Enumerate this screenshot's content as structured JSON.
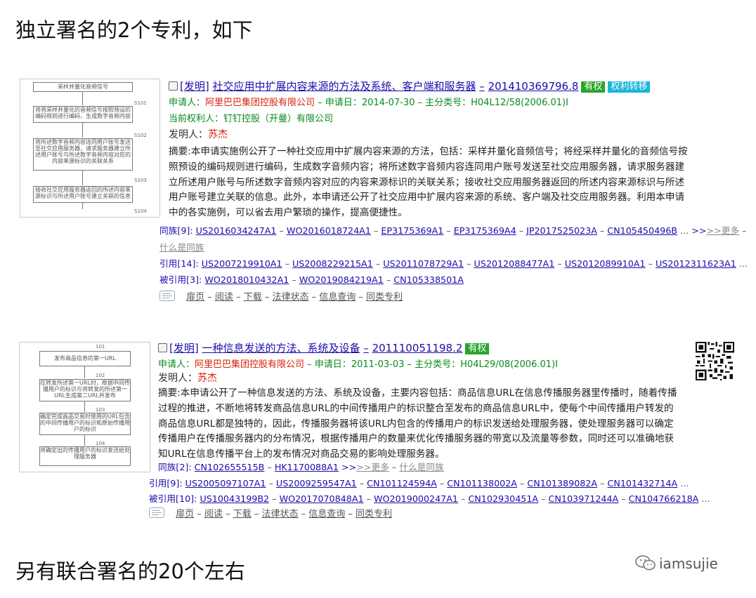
{
  "heading_top": "独立署名的2个专利，如下",
  "heading_bottom": "另有联合署名的20个左右",
  "watermark": "iamsujie",
  "icons": {
    "wechat": "wechat-icon",
    "qr": "qr-code-icon",
    "toolbar": "page-icon",
    "checkbox": "checkbox-icon"
  },
  "colors": {
    "link": "#1a0dab",
    "green": "#0a8a1f",
    "red": "#d9210b",
    "tag_valid": "#2aa52a",
    "tag_transfer": "#18b6d9"
  },
  "patent1": {
    "figure": {
      "top_label": "采样并量化音频信号",
      "boxes": [
        "将将采样并量化的音频信号按照预设的编码规则进行编码，生成数字音频内容",
        "将所述数字音频内容连同用户账号发送至社交应用服务器，请求服务器建立所述用户账号与所述数字音频内容对应的内容来源标识的关联关系",
        "接收社交应用服务器返回的所述内容来源标识与所述用户账号建立关联的信息"
      ],
      "steps": [
        "S101",
        "S102",
        "S103",
        "S104"
      ]
    },
    "type_label": "[发明]",
    "title": "社交应用中扩展内容来源的方法及系统、客户端和服务器",
    "number": "201410369796.8",
    "tags": [
      "有权",
      "权利转移"
    ],
    "applicant_label": "申请人：",
    "applicant": "阿里巴巴集团控股有限公司",
    "app_date_label": "申请日：",
    "app_date": "2014-07-30",
    "class_label": "主分类号：",
    "class": "H04L12/58(2006.01)I",
    "holder_label": "当前权利人：",
    "holder": "钉钉控股（开曼）有限公司",
    "inventor_label": "发明人：",
    "inventor": "苏杰",
    "abstract": [
      "摘要:本申请实施例公开了一种社交应用中扩展内容来源的方法，包括：采样并量化音频信号；将经采样并量化的音频信号按",
      "照预设的编码规则进行编码，生成数字音频内容；将所述数字音频内容连同用户账号发送至社交应用服务器，请求服务器建",
      "立所述用户账号与所述数字音频内容对应的内容来源标识的关联关系；接收社交应用服务器返回的所述内容来源标识与所述",
      "用户账号建立关联的信息。此外，本申请还公开了社交应用中扩展内容来源的系统、客户端及社交应用服务器。利用本申请",
      "中的各实施例，可以省去用户繁琐的操作，提高便捷性。"
    ],
    "family_label": "同族[9]:",
    "family": [
      "US2016034247A1",
      "WO2016018724A1",
      "EP3175369A1",
      "EP3175369A4",
      "JP2017525023A",
      "CN105450496B"
    ],
    "more": ">>更多",
    "what_family": "什么是同族",
    "cited_label": "引用[14]:",
    "cited": [
      "US2007219910A1",
      "US2008229215A1",
      "US2011078729A1",
      "US2012088477A1",
      "US2012089910A1",
      "US2012311623A1"
    ],
    "cited_by_label": "被引用[3]:",
    "cited_by": [
      "WO2018010432A1",
      "WO2019084219A1",
      "CN105338501A"
    ],
    "toolbar": [
      "扉页",
      "阅读",
      "下载",
      "法律状态",
      "信息查询",
      "同类专利"
    ]
  },
  "patent2": {
    "figure": {
      "boxes": [
        "发布商品信息的第一URL",
        "在转发所述第一URL时，根据中间传播用户的标识与将转发的所述第一URL生成第二URL并发布",
        "确定完成商品交易时使用的URL包含的中间传播用户的标识和原始传播用户的标识",
        "将确定出的传播用户的标识发送给处理服务器"
      ],
      "steps": [
        "101",
        "102",
        "103",
        "104"
      ]
    },
    "type_label": "[发明]",
    "title": "一种信息发送的方法、系统及设备",
    "number": "201110051198.2",
    "tags": [
      "有权"
    ],
    "applicant_label": "申请人：",
    "applicant": "阿里巴巴集团控股有限公司",
    "app_date_label": "申请日：",
    "app_date": "2011-03-03",
    "class_label": "主分类号：",
    "class": "H04L29/08(2006.01)I",
    "inventor_label": "发明人：",
    "inventor": "苏杰",
    "abstract": [
      "摘要:本申请公开了一种信息发送的方法、系统及设备，主要内容包括：商品信息URL在信息传播服务器里传播时，随着传播",
      "过程的推进，不断地将转发商品信息URL的中间传播用户的标识整合至发布的商品信息URL中，使每个中间传播用户转发的",
      "商品信息URL都是独特的，因此，传播服务器将该URL内包含的传播用户的标识发送给处理服务器，使处理服务器可以确定",
      "传播用户在传播服务器内的分布情况，根据传播用户的数量来优化传播服务器的带宽以及流量等参数，同时还可以准确地获",
      "知URL在信息传播平台上的发布情况对商品交易的影响处理服务器。"
    ],
    "family_label": "同族[2]:",
    "family": [
      "CN102655515B",
      "HK1170088A1"
    ],
    "more": ">>更多",
    "what_family": "什么是同族",
    "cited_label": "引用[9]:",
    "cited": [
      "US2005097107A1",
      "US2009259547A1",
      "CN101124594A",
      "CN101138002A",
      "CN101389082A",
      "CN101432714A"
    ],
    "cited_by_label": "被引用[10]:",
    "cited_by": [
      "US10043199B2",
      "WO2017070848A1",
      "WO2019000247A1",
      "CN102930451A",
      "CN103971244A",
      "CN104766218A"
    ],
    "toolbar": [
      "扉页",
      "阅读",
      "下载",
      "法律状态",
      "信息查询",
      "同类专利"
    ]
  }
}
